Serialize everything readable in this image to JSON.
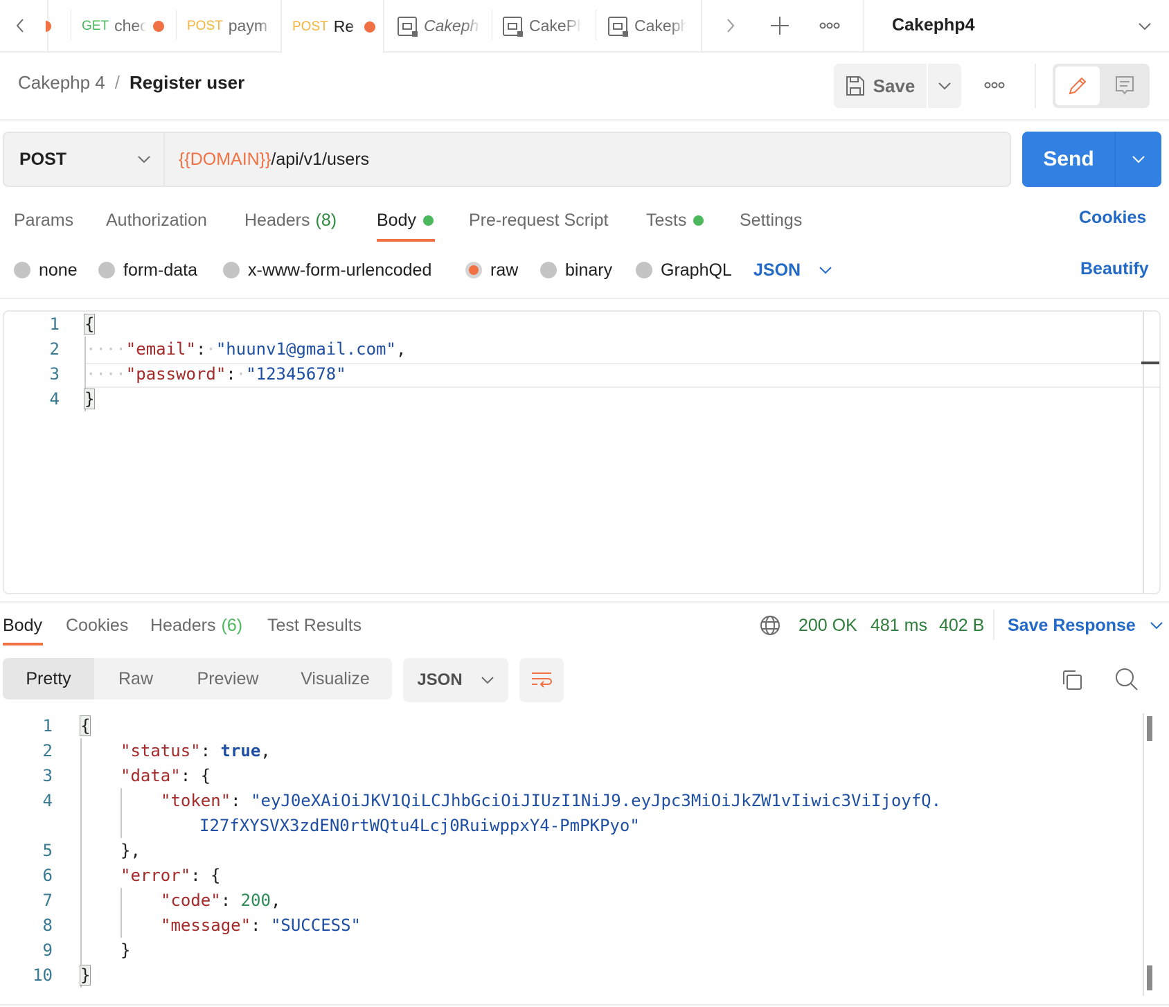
{
  "tabs": {
    "items": [
      {
        "method": "",
        "name": "",
        "unsaved": true
      },
      {
        "method": "GET",
        "method_color": "#4cb85c",
        "name": "chec",
        "unsaved": true
      },
      {
        "method": "POST",
        "method_color": "#f5b43c",
        "name": "paym",
        "unsaved": false
      },
      {
        "method": "POST",
        "method_color": "#f5b43c",
        "name": "Re",
        "unsaved": true,
        "active": true
      },
      {
        "icon": "collection-icon",
        "name": "Cakeph",
        "italic": true
      },
      {
        "icon": "collection-icon",
        "name": "CakePh",
        "italic": false
      },
      {
        "icon": "collection-icon",
        "name": "Cakeph",
        "italic": false
      }
    ],
    "workspace": "Cakephp4"
  },
  "header": {
    "breadcrumb_parent": "Cakephp 4",
    "breadcrumb_sep": "/",
    "title": "Register user",
    "save_label": "Save"
  },
  "request": {
    "method": "POST",
    "url_variable": "{{DOMAIN}}",
    "url_path": "/api/v1/users",
    "send_label": "Send",
    "tabs": [
      {
        "label": "Params"
      },
      {
        "label": "Authorization"
      },
      {
        "label": "Headers",
        "count": "(8)"
      },
      {
        "label": "Body",
        "dot": true,
        "active": true
      },
      {
        "label": "Pre-request Script"
      },
      {
        "label": "Tests",
        "dot": true
      },
      {
        "label": "Settings"
      }
    ],
    "cookies_label": "Cookies",
    "body_types": [
      "none",
      "form-data",
      "x-www-form-urlencoded",
      "raw",
      "binary",
      "GraphQL"
    ],
    "body_type_selected": "raw",
    "body_format": "JSON",
    "beautify_label": "Beautify",
    "body_lines": [
      {
        "n": "1",
        "text": "{"
      },
      {
        "n": "2",
        "key": "\"email\"",
        "value": "\"huunv1@gmail.com\"",
        "trail": ","
      },
      {
        "n": "3",
        "key": "\"password\"",
        "value": "\"12345678\"",
        "trail": ""
      },
      {
        "n": "4",
        "text": "}"
      }
    ]
  },
  "response": {
    "tabs": [
      {
        "label": "Body",
        "active": true
      },
      {
        "label": "Cookies"
      },
      {
        "label": "Headers",
        "count": "(6)"
      },
      {
        "label": "Test Results"
      }
    ],
    "status": "200 OK",
    "time": "481 ms",
    "size": "402 B",
    "save_response_label": "Save Response",
    "views": [
      "Pretty",
      "Raw",
      "Preview",
      "Visualize"
    ],
    "view_selected": "Pretty",
    "format": "JSON",
    "line_numbers": [
      "1",
      "2",
      "3",
      "4",
      "",
      "5",
      "6",
      "7",
      "8",
      "9",
      "10"
    ],
    "body": {
      "status_key": "\"status\"",
      "status_val": "true",
      "data_key": "\"data\"",
      "token_key": "\"token\"",
      "token_val_1": "\"eyJ0eXAiOiJKV1QiLCJhbGciOiJIUzI1NiJ9.eyJpc3MiOiJkZW1vIiwic3ViIjoyfQ.",
      "token_val_2": "I27fXYSVX3zdEN0rtWQtu4Lcj0RuiwppxY4-PmPKPyo\"",
      "error_key": "\"error\"",
      "code_key": "\"code\"",
      "code_val": "200",
      "message_key": "\"message\"",
      "message_val": "\"SUCCESS\""
    }
  },
  "colors": {
    "accent": "#f07244",
    "primary": "#3380e3",
    "link": "#2369c6",
    "success": "#2e7d3a"
  }
}
